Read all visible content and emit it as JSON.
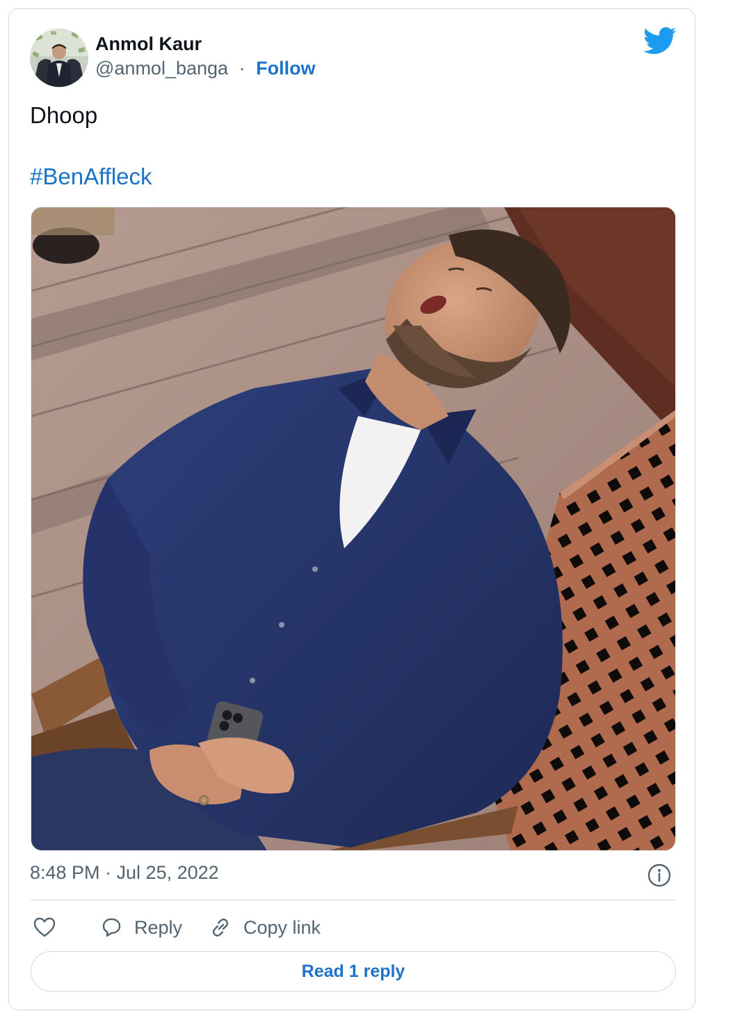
{
  "author": {
    "name": "Anmol Kaur",
    "handle": "@anmol_banga",
    "separator": "·",
    "follow_label": "Follow"
  },
  "tweet": {
    "text": "Dhoop",
    "hashtag": "#BenAffleck",
    "timestamp": "8:48 PM · Jul 25, 2022"
  },
  "actions": {
    "reply_label": "Reply",
    "copy_link_label": "Copy link",
    "read_replies_label": "Read 1 reply"
  },
  "icons": {
    "brand": "twitter-bird-icon",
    "info": "info-icon",
    "like": "heart-icon",
    "reply": "speech-bubble-icon",
    "copy_link": "link-icon"
  },
  "colors": {
    "link_blue": "#1d73c9",
    "twitter_blue": "#1d9bf0",
    "secondary_text": "#536471",
    "border": "#cfd9de"
  }
}
